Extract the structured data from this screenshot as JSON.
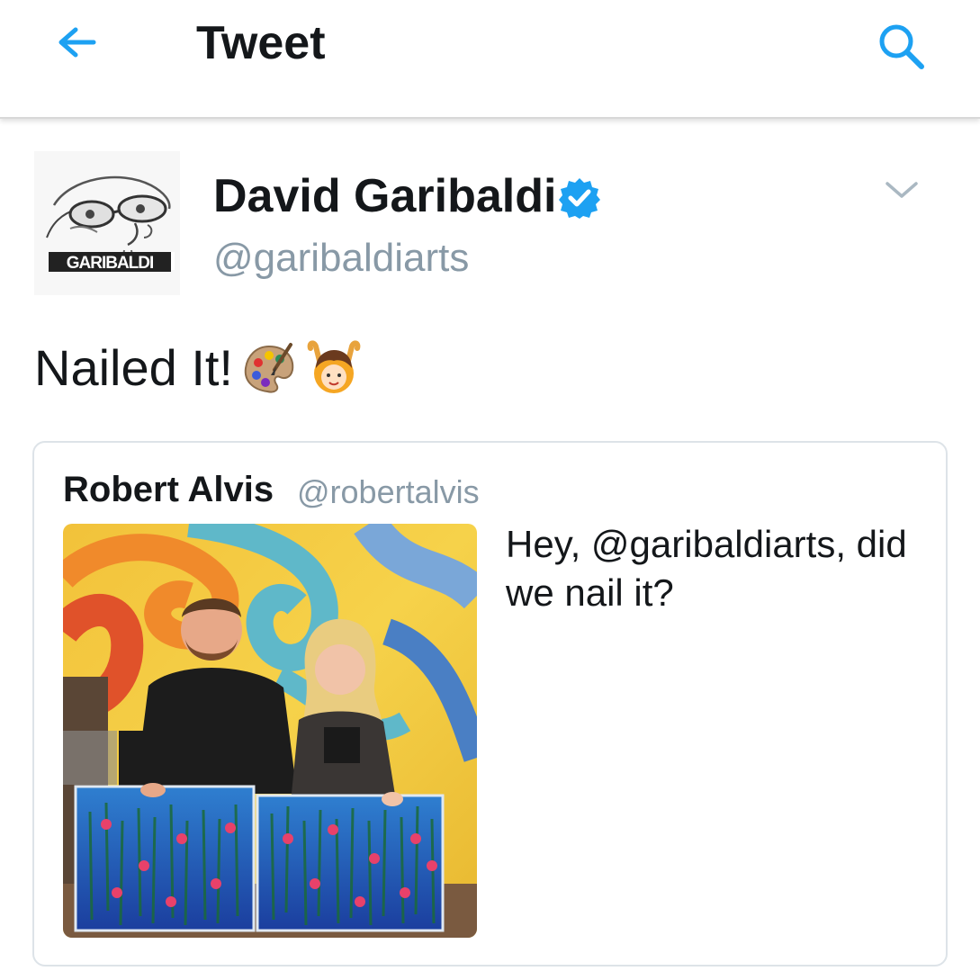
{
  "appbar": {
    "title": "Tweet",
    "back_icon": "arrow-left-icon",
    "search_icon": "search-icon",
    "accent_color": "#1da1f2"
  },
  "author": {
    "name": "David Garibaldi",
    "handle": "@garibaldiarts",
    "verified": true,
    "avatar_logo_text": "GARIBALDI"
  },
  "tweet": {
    "text": "Nailed It!",
    "emojis": [
      "artist-palette-emoji",
      "raising-hands-person-emoji"
    ]
  },
  "quoted_tweet": {
    "name": "Robert Alvis",
    "handle": "@robertalvis",
    "text": "Hey, @garibaldiarts, did we nail it?",
    "photo": "photo-two-people-holding-waterlily-paintings"
  }
}
